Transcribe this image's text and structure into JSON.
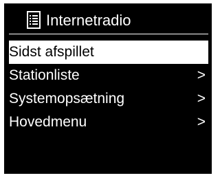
{
  "header": {
    "title": "Internetradio",
    "icon": "list-document-icon"
  },
  "menu": {
    "items": [
      {
        "label": "Sidst afspillet",
        "arrow": "",
        "selected": true
      },
      {
        "label": "Stationliste",
        "arrow": ">",
        "selected": false
      },
      {
        "label": "Systemopsætning",
        "arrow": ">",
        "selected": false
      },
      {
        "label": "Hovedmenu",
        "arrow": ">",
        "selected": false
      }
    ]
  },
  "colors": {
    "background": "#000000",
    "foreground": "#ffffff",
    "highlight": "#ffffff"
  }
}
